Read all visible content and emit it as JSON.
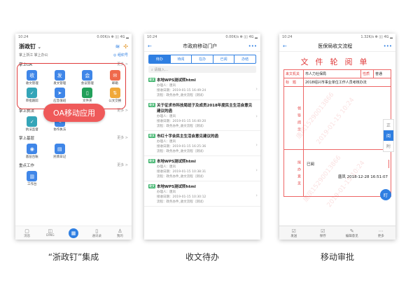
{
  "captions": [
    "“浙政钉”集成",
    "收文待办",
    "移动审批"
  ],
  "phone1": {
    "status_time": "10:24",
    "status_right": "0.00K/s ✻ ▯▯ 4G ▂",
    "app_title": "浙政钉",
    "location_left": "掌上浙江 掌上办公",
    "location_right": "组织号",
    "oa_section": "掌上OA",
    "more": "更多 >",
    "oa_apps": [
      {
        "label": "收文管理",
        "icon": "收",
        "color": "#3f86e8"
      },
      {
        "label": "发文管理",
        "icon": "发",
        "color": "#3f86e8"
      },
      {
        "label": "会议管理",
        "icon": "会",
        "color": "#3f86e8"
      },
      {
        "label": "邮箱",
        "icon": "✉",
        "color": "#ef6a4c"
      },
      {
        "label": "审批跟踪",
        "icon": "✓",
        "color": "#34a5b8"
      },
      {
        "label": "应急值班",
        "icon": "➤",
        "color": "#3f86e8"
      },
      {
        "label": "文件夹",
        "icon": "▯",
        "color": "#22a05a"
      },
      {
        "label": "公文交换",
        "icon": "⇅",
        "color": "#f0a83a"
      }
    ],
    "oa_badge": "OA移动应用",
    "section2": "掌上执法",
    "section2_apps": [
      {
        "label": "执法监督",
        "icon": "✓",
        "color": "#34a5b8"
      },
      {
        "label": "协作执法",
        "icon": "✎",
        "color": "#3f86e8"
      }
    ],
    "section3": "掌上基层",
    "section3_apps": [
      {
        "label": "基层台账",
        "icon": "◉",
        "color": "#3f86e8"
      },
      {
        "label": "民情日记",
        "icon": "▤",
        "color": "#3f86e8"
      }
    ],
    "section4": "重点工作",
    "section4_apps": [
      {
        "label": "工作台",
        "icon": "▥",
        "color": "#3f86e8"
      }
    ],
    "tabs": [
      {
        "label": "消息",
        "icon": "▢"
      },
      {
        "label": "DING",
        "icon": "◫"
      },
      {
        "label": "",
        "icon": "▦"
      },
      {
        "label": "通讯录",
        "icon": "▯"
      },
      {
        "label": "我的",
        "icon": "♙"
      }
    ]
  },
  "phone2": {
    "status_time": "10:24",
    "status_right": "0.00K/s ✻ ▯▯ 4G ▂",
    "title": "市政府移动门户",
    "segments": [
      "待办",
      "待阅",
      "在办",
      "已阅",
      "办结"
    ],
    "active_segment": 0,
    "search_placeholder": "请输入...",
    "docs": [
      {
        "tag": "收文",
        "title": "本地WPS测试转html",
        "handler": "办理人：唐凤",
        "date": "接收日期：2019-01-15 16:49:24",
        "process": "流程：政务办件_收文流程（测试）"
      },
      {
        "tag": "收文",
        "title": "关于征求市科技局班子及成员2018年度民主生活会意见建议的函",
        "handler": "办理人：唐凤",
        "date": "接收日期：2019-01-15 16:40:20",
        "process": "流程：政务办件_收文流程（测试）"
      },
      {
        "tag": "收文",
        "title": "市红十字会民主生活会意见建议的函",
        "handler": "办理人：唐凤",
        "date": "接收日期：2019-01-15 16:25:36",
        "process": "流程：政务办件_收文流程（测试）"
      },
      {
        "tag": "收文",
        "title": "本地WPS测试转html",
        "handler": "办理人：唐凤",
        "date": "接收日期：2019-01-15 10:38:31",
        "process": "流程：政务办件_收文流程（测试）"
      },
      {
        "tag": "收文",
        "title": "本地WPS测试转html",
        "handler": "办理人：唐凤",
        "date": "接收日期：2019-01-15 10:30:12",
        "process": "流程：政务办件_收文流程（测试）"
      }
    ]
  },
  "phone3": {
    "status_time": "10:24",
    "status_right": "1.32K/s ✻ ▯▯ 4G ▂",
    "title": "医保局收文流程",
    "form_title": "文件轮阅单",
    "row1": {
      "label": "来文机关",
      "value": "市人力社保局",
      "prop_label": "性质",
      "prop_value": "普通"
    },
    "row2": {
      "label": "标　题",
      "value": "2018绍兴市事业单位工作人员考核办法"
    },
    "row3": {
      "label": "领导阅示"
    },
    "row4": {
      "label": "拟办意见",
      "value": "已阅",
      "sign": "唐凤 2018-12-28 16:51:07"
    },
    "side_tabs": [
      "正",
      "阅",
      "附"
    ],
    "active_side": 1,
    "float_button": "盯",
    "watermarks": [
      "唐凤15290013866",
      "2019-01-15 10:24",
      "唐凤15290013866",
      "2019-01-15 10:24"
    ],
    "actions": [
      {
        "label": "发送",
        "icon": "☑"
      },
      {
        "label": "保存",
        "icon": "☑"
      },
      {
        "label": "编辑意见",
        "icon": "✎"
      },
      {
        "label": "更多",
        "icon": "⋯"
      }
    ]
  }
}
